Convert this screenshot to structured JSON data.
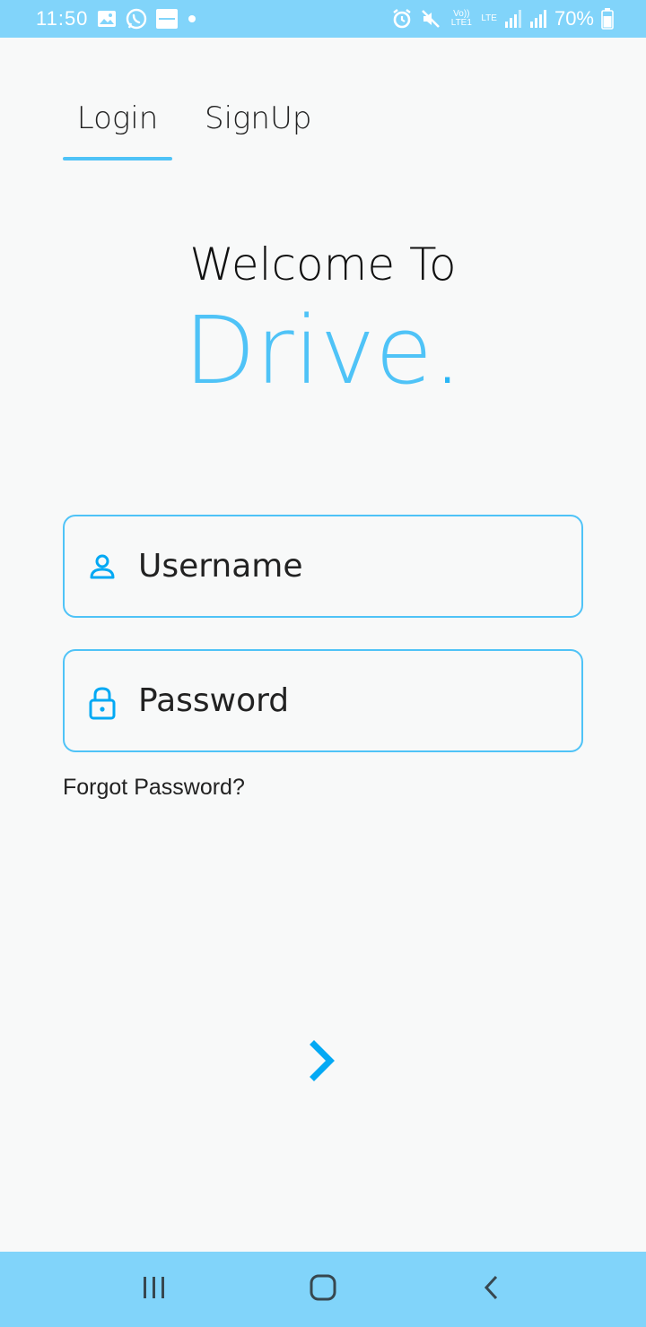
{
  "status_bar": {
    "time": "11:50",
    "network_volte": "Vo)) LTE1",
    "network_lte": "LTE",
    "battery": "70%",
    "icons": [
      "gallery-icon",
      "whatsapp-icon",
      "app-notification-icon",
      "dot-icon",
      "alarm-icon",
      "mute-icon",
      "signal-icon",
      "signal-icon",
      "battery-icon"
    ]
  },
  "tabs": [
    {
      "label": "Login",
      "active": true
    },
    {
      "label": "SignUp",
      "active": false
    }
  ],
  "heading": {
    "welcome": "Welcome To",
    "brand": "Drive",
    "brand_dot": "."
  },
  "form": {
    "username_placeholder": "Username",
    "password_placeholder": "Password",
    "forgot_label": "Forgot Password?"
  },
  "colors": {
    "accent": "#4fc3f7",
    "bars": "#81d4fa",
    "icon": "#03a9f4"
  },
  "nav": {
    "icons": [
      "recents-icon",
      "home-icon",
      "back-icon"
    ]
  }
}
